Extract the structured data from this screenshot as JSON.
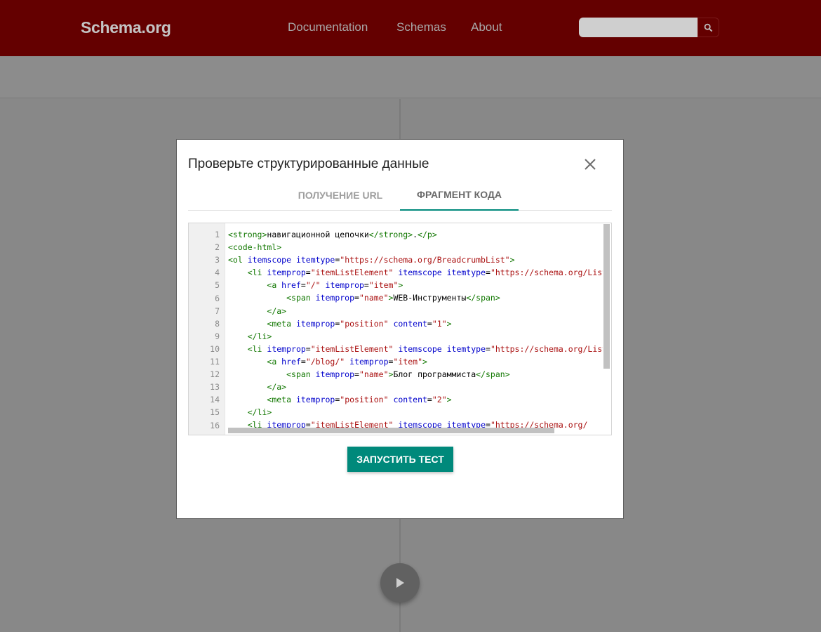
{
  "header": {
    "logo": "Schema.org",
    "nav": [
      "Documentation",
      "Schemas",
      "About"
    ],
    "search": {
      "value": "",
      "placeholder": ""
    }
  },
  "dialog": {
    "title": "Проверьте структурированные данные",
    "tabs": [
      {
        "label": "ПОЛУЧЕНИЕ URL",
        "active": false
      },
      {
        "label": "ФРАГМЕНТ КОДА",
        "active": true
      }
    ],
    "run_button": "ЗАПУСТИТЬ ТЕСТ"
  },
  "editor": {
    "line_numbers": [
      "1",
      "2",
      "3",
      "4",
      "5",
      "6",
      "7",
      "8",
      "9",
      "10",
      "11",
      "12",
      "13",
      "14",
      "15",
      "16"
    ],
    "lines": [
      [
        [
          "tag",
          "<strong>"
        ],
        [
          "txt",
          "навигационной цепочки"
        ],
        [
          "tag",
          "</strong>"
        ],
        [
          "txt",
          "."
        ],
        [
          "tag",
          "</p>"
        ]
      ],
      [
        [
          "tag",
          "<code-html>"
        ]
      ],
      [
        [
          "tag",
          "<ol "
        ],
        [
          "attr",
          "itemscope itemtype"
        ],
        [
          "txt",
          "="
        ],
        [
          "str",
          "\"https://schema.org/BreadcrumbList\""
        ],
        [
          "tag",
          ">"
        ]
      ],
      [
        [
          "txt",
          "    "
        ],
        [
          "tag",
          "<li "
        ],
        [
          "attr",
          "itemprop"
        ],
        [
          "txt",
          "="
        ],
        [
          "str",
          "\"itemListElement\""
        ],
        [
          "txt",
          " "
        ],
        [
          "attr",
          "itemscope itemtype"
        ],
        [
          "txt",
          "="
        ],
        [
          "str",
          "\"https://schema.org/ListItem\""
        ],
        [
          "tag",
          ">"
        ]
      ],
      [
        [
          "txt",
          "        "
        ],
        [
          "tag",
          "<a "
        ],
        [
          "attr",
          "href"
        ],
        [
          "txt",
          "="
        ],
        [
          "str",
          "\"/\""
        ],
        [
          "txt",
          " "
        ],
        [
          "attr",
          "itemprop"
        ],
        [
          "txt",
          "="
        ],
        [
          "str",
          "\"item\""
        ],
        [
          "tag",
          ">"
        ]
      ],
      [
        [
          "txt",
          "            "
        ],
        [
          "tag",
          "<span "
        ],
        [
          "attr",
          "itemprop"
        ],
        [
          "txt",
          "="
        ],
        [
          "str",
          "\"name\""
        ],
        [
          "tag",
          ">"
        ],
        [
          "txt",
          "WEB-Инструменты"
        ],
        [
          "tag",
          "</span>"
        ]
      ],
      [
        [
          "txt",
          "        "
        ],
        [
          "tag",
          "</a>"
        ]
      ],
      [
        [
          "txt",
          "        "
        ],
        [
          "tag",
          "<meta "
        ],
        [
          "attr",
          "itemprop"
        ],
        [
          "txt",
          "="
        ],
        [
          "str",
          "\"position\""
        ],
        [
          "txt",
          " "
        ],
        [
          "attr",
          "content"
        ],
        [
          "txt",
          "="
        ],
        [
          "str",
          "\"1\""
        ],
        [
          "tag",
          ">"
        ]
      ],
      [
        [
          "txt",
          "    "
        ],
        [
          "tag",
          "</li>"
        ]
      ],
      [
        [
          "txt",
          "    "
        ],
        [
          "tag",
          "<li "
        ],
        [
          "attr",
          "itemprop"
        ],
        [
          "txt",
          "="
        ],
        [
          "str",
          "\"itemListElement\""
        ],
        [
          "txt",
          " "
        ],
        [
          "attr",
          "itemscope itemtype"
        ],
        [
          "txt",
          "="
        ],
        [
          "str",
          "\"https://schema.org/ListItem\""
        ],
        [
          "tag",
          ">"
        ]
      ],
      [
        [
          "txt",
          "        "
        ],
        [
          "tag",
          "<a "
        ],
        [
          "attr",
          "href"
        ],
        [
          "txt",
          "="
        ],
        [
          "str",
          "\"/blog/\""
        ],
        [
          "txt",
          " "
        ],
        [
          "attr",
          "itemprop"
        ],
        [
          "txt",
          "="
        ],
        [
          "str",
          "\"item\""
        ],
        [
          "tag",
          ">"
        ]
      ],
      [
        [
          "txt",
          "            "
        ],
        [
          "tag",
          "<span "
        ],
        [
          "attr",
          "itemprop"
        ],
        [
          "txt",
          "="
        ],
        [
          "str",
          "\"name\""
        ],
        [
          "tag",
          ">"
        ],
        [
          "txt",
          "Блог программиста"
        ],
        [
          "tag",
          "</span>"
        ]
      ],
      [
        [
          "txt",
          "        "
        ],
        [
          "tag",
          "</a>"
        ]
      ],
      [
        [
          "txt",
          "        "
        ],
        [
          "tag",
          "<meta "
        ],
        [
          "attr",
          "itemprop"
        ],
        [
          "txt",
          "="
        ],
        [
          "str",
          "\"position\""
        ],
        [
          "txt",
          " "
        ],
        [
          "attr",
          "content"
        ],
        [
          "txt",
          "="
        ],
        [
          "str",
          "\"2\""
        ],
        [
          "tag",
          ">"
        ]
      ],
      [
        [
          "txt",
          "    "
        ],
        [
          "tag",
          "</li>"
        ]
      ],
      [
        [
          "txt",
          "    "
        ],
        [
          "tag",
          "<li "
        ],
        [
          "attr",
          "itemprop"
        ],
        [
          "txt",
          "="
        ],
        [
          "str",
          "\"itemListElement\""
        ],
        [
          "txt",
          " "
        ],
        [
          "attr",
          "itemscope itemtype"
        ],
        [
          "txt",
          "="
        ],
        [
          "str",
          "\"https://schema.org/"
        ]
      ]
    ]
  },
  "colors": {
    "header_bg": "#640000",
    "accent": "#00897b",
    "overlay": "#888888",
    "syntax_tag": "#117700",
    "syntax_attr": "#0000cc",
    "syntax_string": "#aa1111"
  },
  "icons": {
    "search": "search-icon",
    "close": "close-icon",
    "play": "play-icon"
  }
}
